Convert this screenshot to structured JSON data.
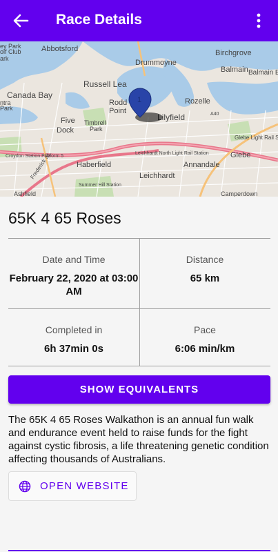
{
  "appbar": {
    "title": "Race Details"
  },
  "map": {
    "labels": [
      "Abbotsford",
      "Drummoyne",
      "Birchgrove",
      "Balmain",
      "Balmain East",
      "Russell Lea",
      "Rodd",
      "Point",
      "Rozelle",
      "Canada Bay",
      "Five",
      "Dock",
      "Timbrell",
      "Park",
      "Lilyfield",
      "Glebe Light Rail Station",
      "Glebe",
      "Haberfield",
      "Leichhardt North Light Rail Station",
      "Annandale",
      "Croydon Station Platform 5",
      "Summer Hill Station",
      "Leichhardt",
      "Frederick St",
      "Ashfield",
      "Camperdown",
      "ey Park",
      "olf Club",
      "ark",
      "ntra",
      "Park",
      "A40"
    ]
  },
  "race": {
    "name": "65K 4 65 Roses",
    "date_label": "Date and Time",
    "date_value": "February 22, 2020 at 03:00 AM",
    "distance_label": "Distance",
    "distance_value": "65 km",
    "completed_label": "Completed in",
    "completed_value": "6h 37min 0s",
    "pace_label": "Pace",
    "pace_value": "6:06 min/km"
  },
  "actions": {
    "equivalents_label": "SHOW EQUIVALENTS",
    "website_label": "OPEN WEBSITE"
  },
  "description": "The 65K 4 65 Roses Walkathon is an annual fun walk and endurance event held to raise funds for the fight against cystic fibrosis, a life threatening genetic condition affecting thousands of Australians.",
  "colors": {
    "primary": "#6200ee",
    "water": "#a9cbe8",
    "land": "#ebe6df"
  }
}
